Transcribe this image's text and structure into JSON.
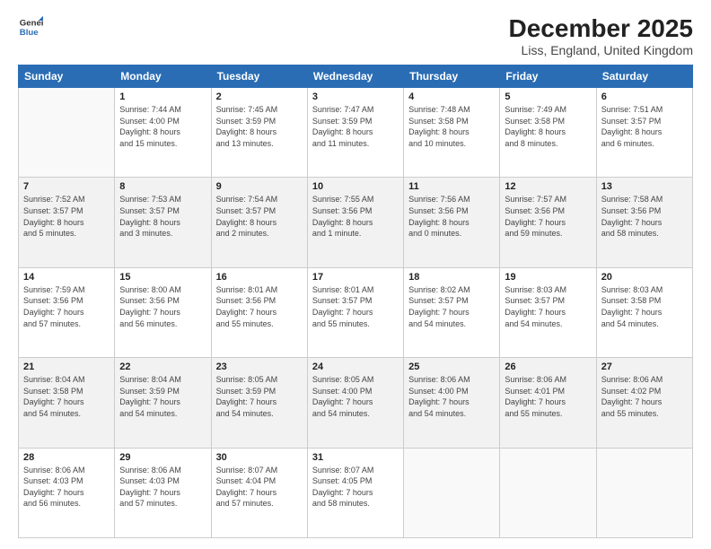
{
  "logo": {
    "general": "General",
    "blue": "Blue"
  },
  "header": {
    "title": "December 2025",
    "subtitle": "Liss, England, United Kingdom"
  },
  "weekdays": [
    "Sunday",
    "Monday",
    "Tuesday",
    "Wednesday",
    "Thursday",
    "Friday",
    "Saturday"
  ],
  "weeks": [
    [
      {
        "num": "",
        "info": ""
      },
      {
        "num": "1",
        "info": "Sunrise: 7:44 AM\nSunset: 4:00 PM\nDaylight: 8 hours\nand 15 minutes."
      },
      {
        "num": "2",
        "info": "Sunrise: 7:45 AM\nSunset: 3:59 PM\nDaylight: 8 hours\nand 13 minutes."
      },
      {
        "num": "3",
        "info": "Sunrise: 7:47 AM\nSunset: 3:59 PM\nDaylight: 8 hours\nand 11 minutes."
      },
      {
        "num": "4",
        "info": "Sunrise: 7:48 AM\nSunset: 3:58 PM\nDaylight: 8 hours\nand 10 minutes."
      },
      {
        "num": "5",
        "info": "Sunrise: 7:49 AM\nSunset: 3:58 PM\nDaylight: 8 hours\nand 8 minutes."
      },
      {
        "num": "6",
        "info": "Sunrise: 7:51 AM\nSunset: 3:57 PM\nDaylight: 8 hours\nand 6 minutes."
      }
    ],
    [
      {
        "num": "7",
        "info": "Sunrise: 7:52 AM\nSunset: 3:57 PM\nDaylight: 8 hours\nand 5 minutes."
      },
      {
        "num": "8",
        "info": "Sunrise: 7:53 AM\nSunset: 3:57 PM\nDaylight: 8 hours\nand 3 minutes."
      },
      {
        "num": "9",
        "info": "Sunrise: 7:54 AM\nSunset: 3:57 PM\nDaylight: 8 hours\nand 2 minutes."
      },
      {
        "num": "10",
        "info": "Sunrise: 7:55 AM\nSunset: 3:56 PM\nDaylight: 8 hours\nand 1 minute."
      },
      {
        "num": "11",
        "info": "Sunrise: 7:56 AM\nSunset: 3:56 PM\nDaylight: 8 hours\nand 0 minutes."
      },
      {
        "num": "12",
        "info": "Sunrise: 7:57 AM\nSunset: 3:56 PM\nDaylight: 7 hours\nand 59 minutes."
      },
      {
        "num": "13",
        "info": "Sunrise: 7:58 AM\nSunset: 3:56 PM\nDaylight: 7 hours\nand 58 minutes."
      }
    ],
    [
      {
        "num": "14",
        "info": "Sunrise: 7:59 AM\nSunset: 3:56 PM\nDaylight: 7 hours\nand 57 minutes."
      },
      {
        "num": "15",
        "info": "Sunrise: 8:00 AM\nSunset: 3:56 PM\nDaylight: 7 hours\nand 56 minutes."
      },
      {
        "num": "16",
        "info": "Sunrise: 8:01 AM\nSunset: 3:56 PM\nDaylight: 7 hours\nand 55 minutes."
      },
      {
        "num": "17",
        "info": "Sunrise: 8:01 AM\nSunset: 3:57 PM\nDaylight: 7 hours\nand 55 minutes."
      },
      {
        "num": "18",
        "info": "Sunrise: 8:02 AM\nSunset: 3:57 PM\nDaylight: 7 hours\nand 54 minutes."
      },
      {
        "num": "19",
        "info": "Sunrise: 8:03 AM\nSunset: 3:57 PM\nDaylight: 7 hours\nand 54 minutes."
      },
      {
        "num": "20",
        "info": "Sunrise: 8:03 AM\nSunset: 3:58 PM\nDaylight: 7 hours\nand 54 minutes."
      }
    ],
    [
      {
        "num": "21",
        "info": "Sunrise: 8:04 AM\nSunset: 3:58 PM\nDaylight: 7 hours\nand 54 minutes."
      },
      {
        "num": "22",
        "info": "Sunrise: 8:04 AM\nSunset: 3:59 PM\nDaylight: 7 hours\nand 54 minutes."
      },
      {
        "num": "23",
        "info": "Sunrise: 8:05 AM\nSunset: 3:59 PM\nDaylight: 7 hours\nand 54 minutes."
      },
      {
        "num": "24",
        "info": "Sunrise: 8:05 AM\nSunset: 4:00 PM\nDaylight: 7 hours\nand 54 minutes."
      },
      {
        "num": "25",
        "info": "Sunrise: 8:06 AM\nSunset: 4:00 PM\nDaylight: 7 hours\nand 54 minutes."
      },
      {
        "num": "26",
        "info": "Sunrise: 8:06 AM\nSunset: 4:01 PM\nDaylight: 7 hours\nand 55 minutes."
      },
      {
        "num": "27",
        "info": "Sunrise: 8:06 AM\nSunset: 4:02 PM\nDaylight: 7 hours\nand 55 minutes."
      }
    ],
    [
      {
        "num": "28",
        "info": "Sunrise: 8:06 AM\nSunset: 4:03 PM\nDaylight: 7 hours\nand 56 minutes."
      },
      {
        "num": "29",
        "info": "Sunrise: 8:06 AM\nSunset: 4:03 PM\nDaylight: 7 hours\nand 57 minutes."
      },
      {
        "num": "30",
        "info": "Sunrise: 8:07 AM\nSunset: 4:04 PM\nDaylight: 7 hours\nand 57 minutes."
      },
      {
        "num": "31",
        "info": "Sunrise: 8:07 AM\nSunset: 4:05 PM\nDaylight: 7 hours\nand 58 minutes."
      },
      {
        "num": "",
        "info": ""
      },
      {
        "num": "",
        "info": ""
      },
      {
        "num": "",
        "info": ""
      }
    ]
  ]
}
